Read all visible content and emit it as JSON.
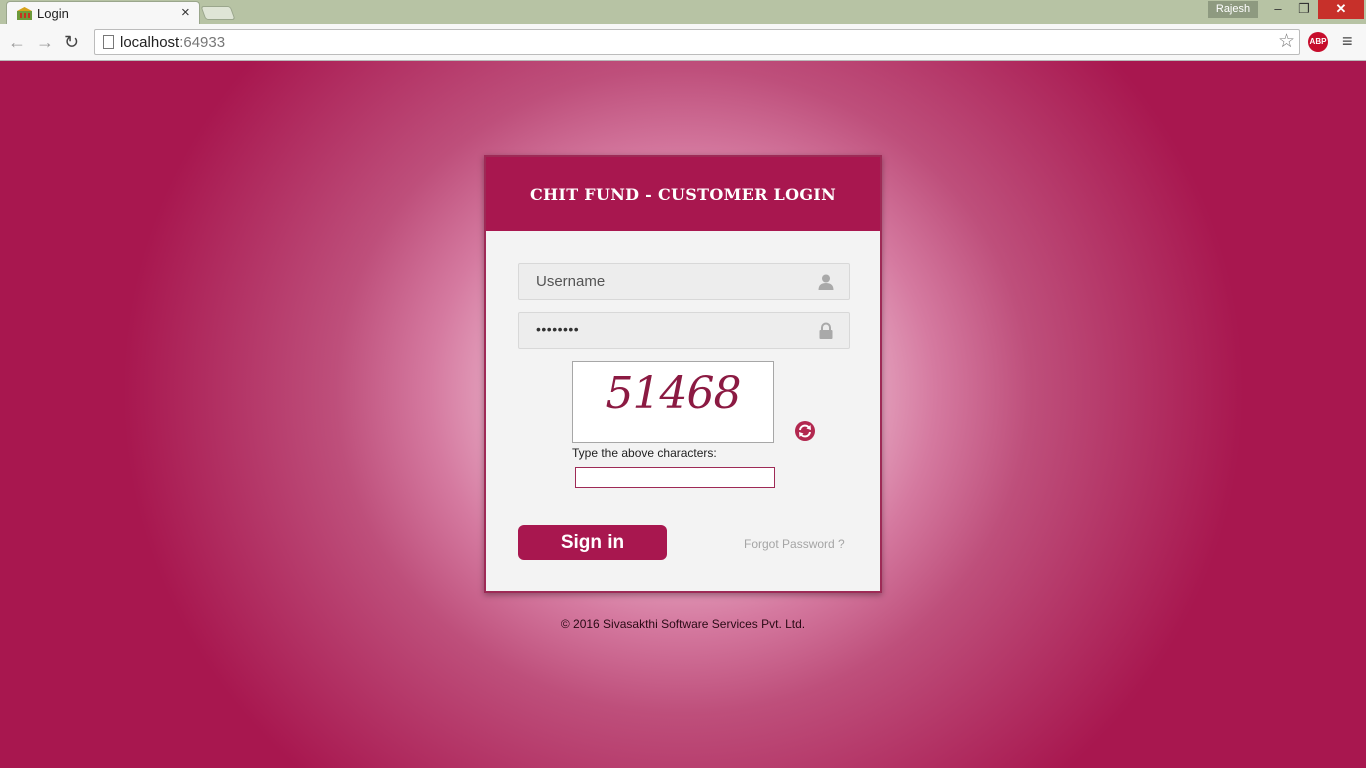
{
  "browser": {
    "tab_title": "Login",
    "tab_close": "×",
    "profile_name": "Rajesh",
    "window_minimize": "–",
    "window_restore": "❐",
    "window_close": "✕",
    "nav_back": "←",
    "nav_forward": "→",
    "nav_reload": "↻",
    "url_host": "localhost",
    "url_port": ":64933",
    "bookmark_star": "☆",
    "adblock_label": "ABP",
    "menu_glyph": "≡"
  },
  "login": {
    "title": "CHIT FUND - CUSTOMER LOGIN",
    "username_placeholder": "Username",
    "password_mask": "••••••••",
    "captcha_text": "51468",
    "captcha_label": "Type the above characters:",
    "signin_label": "Sign in",
    "forgot_label": "Forgot Password ?"
  },
  "footer": {
    "copyright": "© 2016 Sivasakthi Software Services Pvt. Ltd."
  },
  "colors": {
    "brand": "#a8174f",
    "card_bg": "#f3f3f3",
    "chrome_tab_strip": "#b7c3a4",
    "window_close": "#c7302a"
  }
}
